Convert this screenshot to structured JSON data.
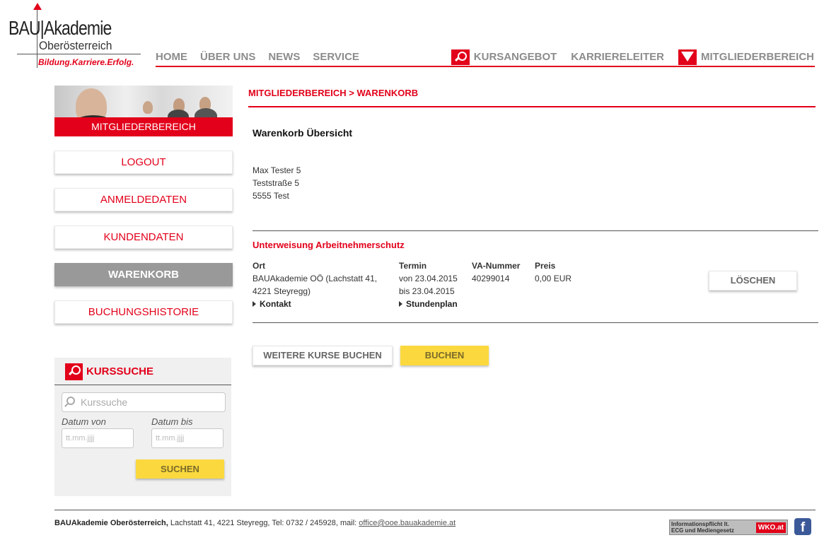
{
  "logo": {
    "brand": "BAU|Akademie",
    "region": "Oberösterreich",
    "claim": "Bildung.Karriere.Erfolg."
  },
  "nav": {
    "left": [
      "HOME",
      "ÜBER UNS",
      "NEWS",
      "SERVICE"
    ],
    "kursangebot": "KURSANGEBOT",
    "karriereleiter": "KARRIERELEITER",
    "mitgliederbereich": "MITGLIEDERBEREICH"
  },
  "sidebar": {
    "banner_label": "MITGLIEDERBEREICH",
    "items": [
      {
        "label": "LOGOUT",
        "active": false
      },
      {
        "label": "ANMELDEDATEN",
        "active": false
      },
      {
        "label": "KUNDENDATEN",
        "active": false
      },
      {
        "label": "WARENKORB",
        "active": true
      },
      {
        "label": "BUCHUNGSHISTORIE",
        "active": false
      }
    ]
  },
  "search": {
    "title": "KURSSUCHE",
    "placeholder": "Kurssuche",
    "date_from_label": "Datum von",
    "date_to_label": "Datum bis",
    "date_placeholder": "tt.mm.jjjj",
    "submit_label": "SUCHEN"
  },
  "main": {
    "breadcrumb": "MITGLIEDERBEREICH > WARENKORB",
    "title": "Warenkorb Übersicht",
    "address": [
      "Max Tester 5",
      "Teststraße 5",
      "5555 Test"
    ],
    "course": {
      "title": "Unterweisung Arbeitnehmerschutz",
      "ort_header": "Ort",
      "ort": [
        "BAUAkademie OÖ (Lachstatt 41,",
        "4221 Steyregg)"
      ],
      "kontakt_link": "Kontakt",
      "termin_header": "Termin",
      "termin": [
        "von 23.04.2015",
        "bis 23.04.2015"
      ],
      "stundenplan_link": "Stundenplan",
      "va_header": "VA-Nummer",
      "va": "40299014",
      "preis_header": "Preis",
      "preis": "0,00 EUR",
      "delete_label": "LÖSCHEN"
    },
    "more_label": "WEITERE KURSE BUCHEN",
    "book_label": "BUCHEN"
  },
  "footer": {
    "org": "BAUAkademie Oberösterreich,",
    "contact": " Lachstatt 41, 4221 Steyregg, Tel: 0732 / 245928, mail: ",
    "email": "office@ooe.bauakademie.at",
    "wko_line1": "Informationspflicht lt.",
    "wko_line2": "ECG und Mediengesetz",
    "wko_brand": "WKO.at",
    "fb": "f"
  },
  "colors": {
    "accent": "#e2001a",
    "button_yellow": "#fbd93e",
    "active_grey": "#999999"
  }
}
